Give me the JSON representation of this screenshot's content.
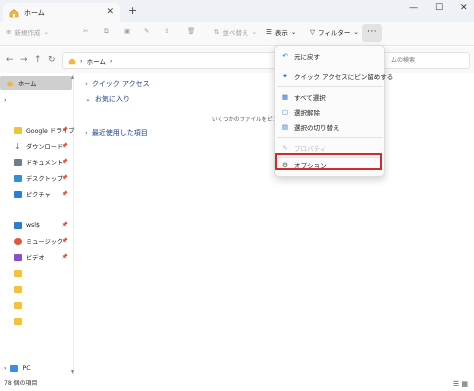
{
  "tab": {
    "title": "ホーム"
  },
  "toolbar": {
    "new_label": "新規作成",
    "sort_label": "並べ替え",
    "view_label": "表示",
    "filter_label": "フィルター",
    "more_label": "···"
  },
  "address": {
    "path": "ホーム",
    "search_placeholder": "ムの検索"
  },
  "sidebar": {
    "home": "ホーム",
    "google_drive": "Google ドライブ",
    "downloads": "ダウンロード",
    "documents": "ドキュメント",
    "desktop": "デスクトップ",
    "pictures": "ピクチャ",
    "wsl": "wsl$",
    "music": "ミュージック",
    "videos": "ビデオ",
    "pc": "PC"
  },
  "main": {
    "quick_access": "クイック アクセス",
    "favorites": "お気に入り",
    "recent": "最近使用した項目",
    "empty_message": "いくつかのファイルをピン留め"
  },
  "menu": {
    "undo": "元に戻す",
    "pin_quick_access": "クイック アクセスにピン留めする",
    "select_all": "すべて選択",
    "deselect": "選択解除",
    "invert_selection": "選択の切り替え",
    "properties": "プロパティ",
    "options": "オプション"
  },
  "status": {
    "count": "78 個の項目"
  },
  "colors": {
    "accent": "#0067c0",
    "highlight": "#d62a2a",
    "folder": "#f3c23b"
  }
}
